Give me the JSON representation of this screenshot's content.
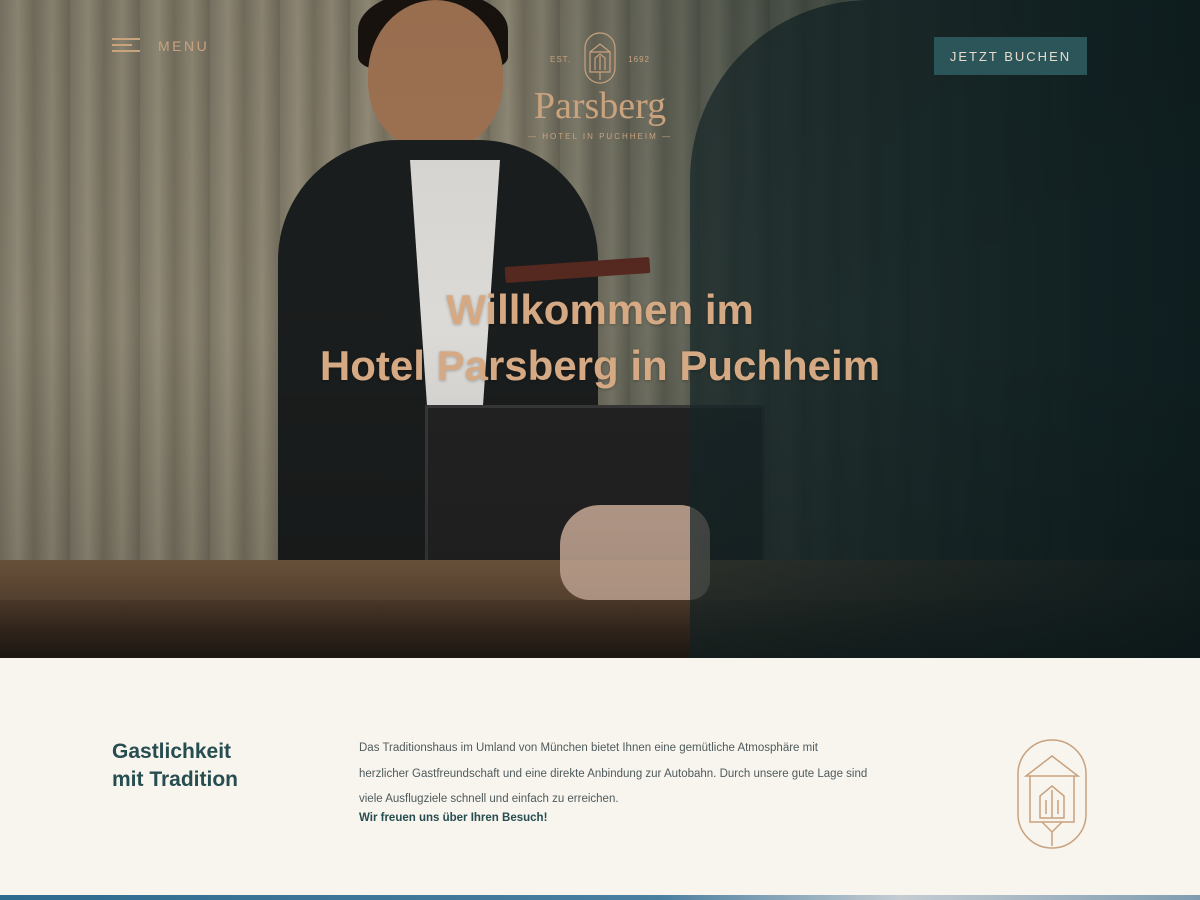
{
  "header": {
    "menu_label": "MENU",
    "book_label": "JETZT BUCHEN",
    "logo": {
      "est": "EST.",
      "year": "1692",
      "name": "Parsberg",
      "subtitle": "— HOTEL IN PUCHHEIM —"
    }
  },
  "hero": {
    "title_line1": "Willkommen im",
    "title_line2": "Hotel Parsberg in Puchheim"
  },
  "intro": {
    "heading_line1": "Gastlichkeit",
    "heading_line2": "mit Tradition",
    "text": "Das Traditionshaus im Umland von München bietet Ihnen eine gemütliche Atmosphäre mit herzlicher Gastfreundschaft und eine direkte Anbindung zur Autobahn. Durch unsere gute Lage sind viele Ausflugziele schnell und einfach zu erreichen.",
    "closing": "Wir freuen uns über Ihren Besuch!"
  },
  "colors": {
    "accent_gold": "#c9a27e",
    "teal": "#2b5559",
    "heading": "#264d50",
    "background": "#f8f4ee"
  },
  "icons": [
    "hamburger-menu-icon",
    "hotel-emblem-icon"
  ]
}
